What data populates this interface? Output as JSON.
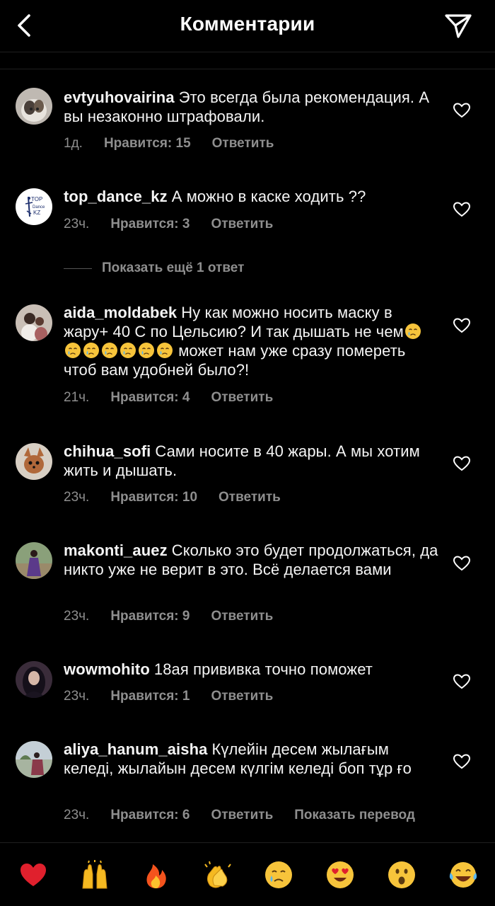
{
  "header": {
    "title": "Комментарии"
  },
  "more_replies_label": "Показать ещё 1 ответ",
  "comments": [
    {
      "user": "evtyuhovairina",
      "text": "Это всегда была рекомендация. А вы незаконно штрафовали.",
      "time": "1д.",
      "likes": "Нравится: 15",
      "reply": "Ответить"
    },
    {
      "user": "top_dance_kz",
      "text": "А можно в каске ходить ??",
      "time": "23ч.",
      "likes": "Нравится: 3",
      "reply": "Ответить",
      "avatar_label": [
        "TOP",
        "Dance",
        "KZ"
      ]
    },
    {
      "user": "aida_moldabek",
      "text_before": "Ну как можно носить маску в жару+ 40 С  по Цельсию?  И так дышать не чем",
      "emoji_count": 7,
      "text_after": " может нам уже сразу помереть чтоб вам удобней было?!",
      "time": "21ч.",
      "likes": "Нравится: 4",
      "reply": "Ответить"
    },
    {
      "user": "chihua_sofi",
      "text": "Сами  носите в 40 жары. А мы хотим жить и дышать.",
      "time": "23ч.",
      "likes": "Нравится: 10",
      "reply": "Ответить"
    },
    {
      "user": "makonti_auez",
      "text": "Сколько это будет продолжаться, да никто уже не верит в это. Всё делается вами",
      "time": "23ч.",
      "likes": "Нравится: 9",
      "reply": "Ответить"
    },
    {
      "user": "wowmohito",
      "text": "18ая прививка точно поможет",
      "time": "23ч.",
      "likes": "Нравится: 1",
      "reply": "Ответить"
    },
    {
      "user": "aliya_hanum_aisha",
      "text": "Күлейін десем жылағым келеді, жылайын десем күлгім келеді боп тұр ғо",
      "time": "23ч.",
      "likes": "Нравится: 6",
      "reply": "Ответить",
      "translate": "Показать перевод"
    }
  ],
  "emoji_bar": [
    "heart-emoji",
    "raised-hands-emoji",
    "fire-emoji",
    "clapping-emoji",
    "crying-emoji",
    "heart-eyes-emoji",
    "surprised-emoji",
    "tears-of-joy-emoji"
  ]
}
